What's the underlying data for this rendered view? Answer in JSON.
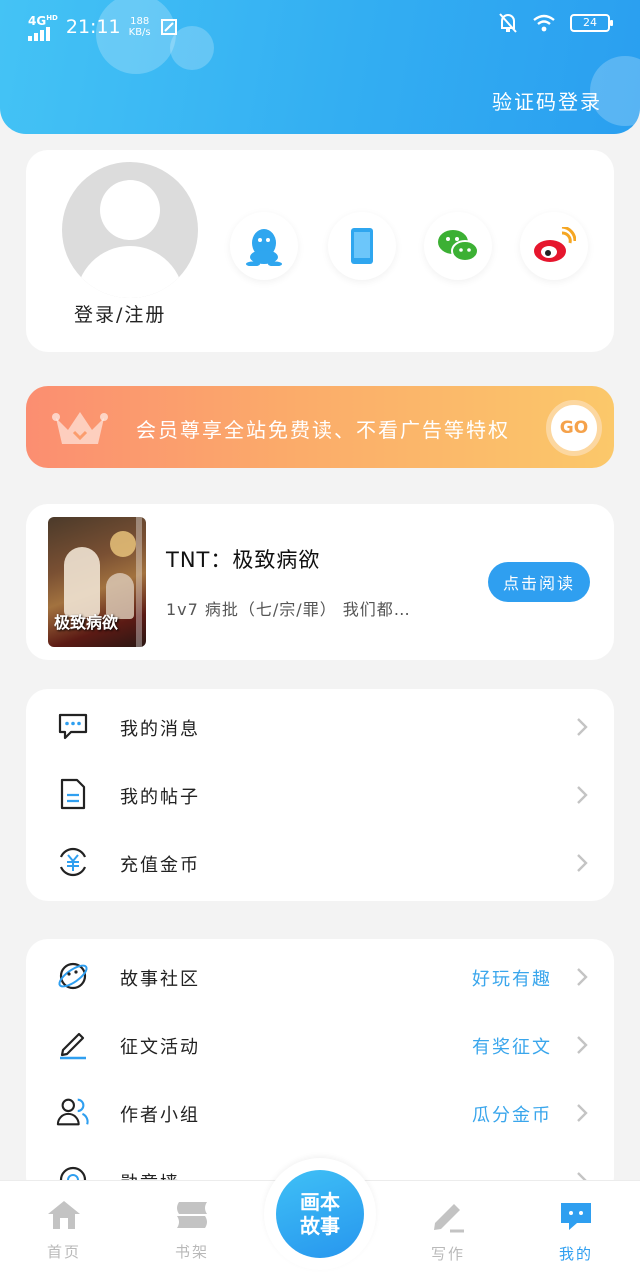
{
  "colors": {
    "accent": "#2f9ff0",
    "header": "#3bb6f4",
    "vip_start": "#fb8e71",
    "vip_end": "#fbc86a",
    "tab_inactive": "#b9b9b9"
  },
  "status_bar": {
    "network": "4G",
    "network_sup": "HD",
    "time": "21:11",
    "speed_value": "188",
    "speed_unit": "KB/s",
    "battery": "24"
  },
  "header": {
    "sms_login": "验证码登录"
  },
  "profile": {
    "login_register": "登录/注册",
    "social_icons": [
      "qq-icon",
      "phone-icon",
      "wechat-icon",
      "weibo-icon"
    ]
  },
  "vip": {
    "text": "会员尊享全站免费读、不看广告等特权",
    "go": "GO",
    "icon": "crown-icon"
  },
  "book": {
    "title": "TNT：极致病欲",
    "desc": "1v7 病批（七/宗/罪） 我们都…",
    "cover_title": "极致病欲",
    "read_button": "点击阅读"
  },
  "menu1": [
    {
      "label": "我的消息",
      "icon": "message-icon"
    },
    {
      "label": "我的帖子",
      "icon": "document-icon"
    },
    {
      "label": "充值金币",
      "icon": "coin-recharge-icon"
    }
  ],
  "menu2": [
    {
      "label": "故事社区",
      "extra": "好玩有趣",
      "icon": "planet-icon"
    },
    {
      "label": "征文活动",
      "extra": "有奖征文",
      "icon": "pen-icon"
    },
    {
      "label": "作者小组",
      "extra": "瓜分金币",
      "icon": "group-icon"
    },
    {
      "label": "勋章墙",
      "extra": "",
      "icon": "medal-icon"
    }
  ],
  "tabbar": {
    "home": "首页",
    "shelf": "书架",
    "center_line1": "画本",
    "center_line2": "故事",
    "write": "写作",
    "mine": "我的"
  }
}
